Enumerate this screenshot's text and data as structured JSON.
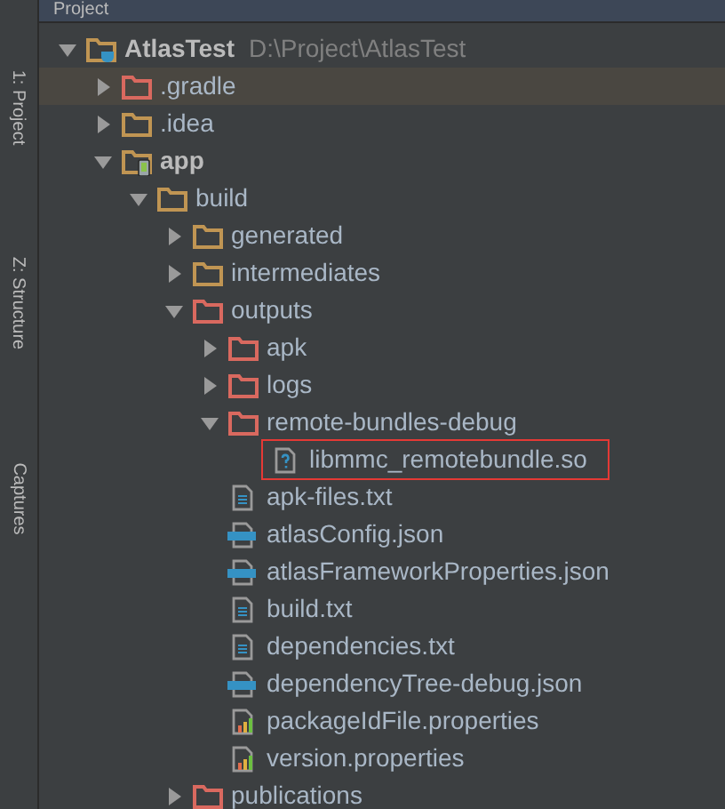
{
  "header": {
    "title": "Project"
  },
  "side_tabs": [
    "1: Project",
    "Z: Structure",
    "Captures"
  ],
  "tree": [
    {
      "label": "AtlasTest",
      "path": "D:\\Project\\AtlasTest",
      "kind": "project",
      "expanded": true,
      "selected": false,
      "marked": false,
      "children": [
        {
          "label": ".gradle",
          "kind": "excluded",
          "expanded": false,
          "selected": true,
          "marked": false
        },
        {
          "label": ".idea",
          "kind": "folder",
          "expanded": false,
          "selected": false,
          "marked": false
        },
        {
          "label": "app",
          "kind": "module",
          "expanded": true,
          "selected": false,
          "marked": false,
          "children": [
            {
              "label": "build",
              "kind": "folder",
              "expanded": true,
              "selected": false,
              "marked": false,
              "children": [
                {
                  "label": "generated",
                  "kind": "folder",
                  "expanded": false,
                  "selected": false,
                  "marked": false
                },
                {
                  "label": "intermediates",
                  "kind": "folder",
                  "expanded": false,
                  "selected": false,
                  "marked": false
                },
                {
                  "label": "outputs",
                  "kind": "excluded",
                  "expanded": true,
                  "selected": false,
                  "marked": false,
                  "children": [
                    {
                      "label": "apk",
                      "kind": "excluded",
                      "expanded": false,
                      "selected": false,
                      "marked": false
                    },
                    {
                      "label": "logs",
                      "kind": "excluded",
                      "expanded": false,
                      "selected": false,
                      "marked": false
                    },
                    {
                      "label": "remote-bundles-debug",
                      "kind": "excluded",
                      "expanded": true,
                      "selected": false,
                      "marked": false,
                      "children": [
                        {
                          "label": "libmmc_remotebundle.so",
                          "kind": "unknown",
                          "selected": false,
                          "marked": true
                        }
                      ]
                    },
                    {
                      "label": "apk-files.txt",
                      "kind": "text",
                      "selected": false,
                      "marked": false
                    },
                    {
                      "label": "atlasConfig.json",
                      "kind": "json",
                      "selected": false,
                      "marked": false
                    },
                    {
                      "label": "atlasFrameworkProperties.json",
                      "kind": "json",
                      "selected": false,
                      "marked": false
                    },
                    {
                      "label": "build.txt",
                      "kind": "text",
                      "selected": false,
                      "marked": false
                    },
                    {
                      "label": "dependencies.txt",
                      "kind": "text",
                      "selected": false,
                      "marked": false
                    },
                    {
                      "label": "dependencyTree-debug.json",
                      "kind": "json",
                      "selected": false,
                      "marked": false
                    },
                    {
                      "label": "packageIdFile.properties",
                      "kind": "properties",
                      "selected": false,
                      "marked": false
                    },
                    {
                      "label": "version.properties",
                      "kind": "properties",
                      "selected": false,
                      "marked": false
                    }
                  ]
                },
                {
                  "label": "publications",
                  "kind": "excluded",
                  "expanded": false,
                  "selected": false,
                  "marked": false
                }
              ]
            }
          ]
        }
      ]
    }
  ]
}
